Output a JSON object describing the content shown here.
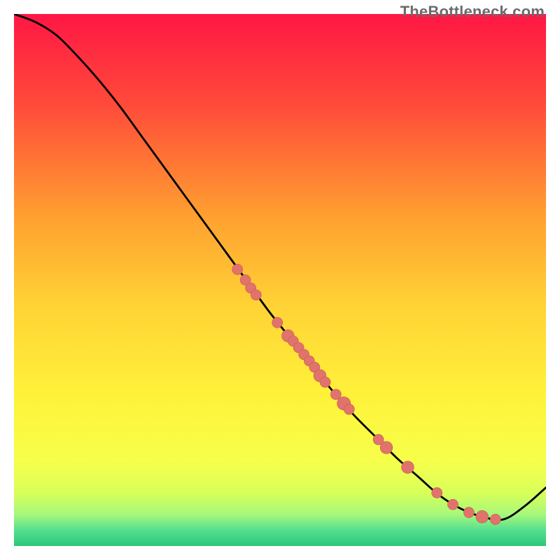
{
  "watermark": "TheBottleneck.com",
  "colors": {
    "gradient_stops": [
      {
        "offset": 0,
        "color": "#ff1744"
      },
      {
        "offset": 0.17,
        "color": "#ff4a3a"
      },
      {
        "offset": 0.38,
        "color": "#ffa030"
      },
      {
        "offset": 0.55,
        "color": "#ffd335"
      },
      {
        "offset": 0.72,
        "color": "#fff23a"
      },
      {
        "offset": 0.84,
        "color": "#f6ff4a"
      },
      {
        "offset": 0.9,
        "color": "#d8ff5a"
      },
      {
        "offset": 0.94,
        "color": "#a8f87a"
      },
      {
        "offset": 0.97,
        "color": "#55e08f"
      },
      {
        "offset": 1.0,
        "color": "#29c77a"
      }
    ],
    "line": "#000000",
    "marker_fill": "#e0736b",
    "marker_stroke": "#c85a52"
  },
  "chart_data": {
    "type": "line",
    "title": "",
    "xlabel": "",
    "ylabel": "",
    "xlim": [
      0,
      100
    ],
    "ylim": [
      0,
      100
    ],
    "series": [
      {
        "name": "curve",
        "x": [
          0,
          4,
          8,
          12,
          16,
          20,
          24,
          28,
          32,
          36,
          40,
          44,
          48,
          52,
          56,
          60,
          64,
          68,
          72,
          76,
          80,
          84,
          88,
          92,
          96,
          100
        ],
        "y": [
          100,
          98.5,
          96,
          92,
          87.5,
          82.5,
          77,
          71.5,
          66,
          60.5,
          55,
          49.5,
          44,
          39,
          34,
          29,
          24.5,
          20.5,
          16.5,
          13,
          9.5,
          7,
          5.5,
          5,
          7.5,
          11
        ]
      }
    ],
    "markers": {
      "name": "highlight-points",
      "points": [
        {
          "x": 42,
          "y": 52,
          "r": 1.1
        },
        {
          "x": 43.5,
          "y": 50,
          "r": 1.1
        },
        {
          "x": 44.5,
          "y": 48.5,
          "r": 1.1
        },
        {
          "x": 45.5,
          "y": 47.2,
          "r": 1.1
        },
        {
          "x": 49.5,
          "y": 42,
          "r": 1.1
        },
        {
          "x": 51.5,
          "y": 39.5,
          "r": 1.3
        },
        {
          "x": 52.5,
          "y": 38.5,
          "r": 1.1
        },
        {
          "x": 53.5,
          "y": 37.3,
          "r": 1.1
        },
        {
          "x": 54.5,
          "y": 36,
          "r": 1.1
        },
        {
          "x": 55.5,
          "y": 34.8,
          "r": 1.1
        },
        {
          "x": 56.5,
          "y": 33.6,
          "r": 1.1
        },
        {
          "x": 57.5,
          "y": 32,
          "r": 1.3
        },
        {
          "x": 58.5,
          "y": 30.8,
          "r": 1.1
        },
        {
          "x": 60.5,
          "y": 28.5,
          "r": 1.1
        },
        {
          "x": 62,
          "y": 26.8,
          "r": 1.4
        },
        {
          "x": 63,
          "y": 25.7,
          "r": 1.1
        },
        {
          "x": 68.5,
          "y": 20,
          "r": 1.1
        },
        {
          "x": 70,
          "y": 18.5,
          "r": 1.3
        },
        {
          "x": 74,
          "y": 14.8,
          "r": 1.3
        },
        {
          "x": 79.5,
          "y": 10,
          "r": 1.1
        },
        {
          "x": 82.5,
          "y": 7.8,
          "r": 1.1
        },
        {
          "x": 85.5,
          "y": 6.3,
          "r": 1.1
        },
        {
          "x": 88,
          "y": 5.5,
          "r": 1.3
        },
        {
          "x": 90.5,
          "y": 5,
          "r": 1.1
        }
      ]
    }
  }
}
